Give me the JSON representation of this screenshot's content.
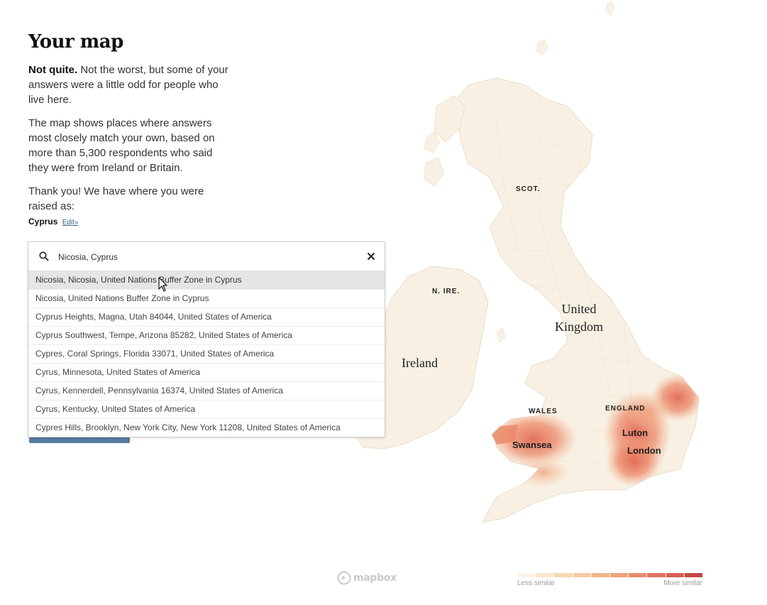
{
  "panel": {
    "title": "Your map",
    "result_lead": "Not quite.",
    "result_text": " Not the worst, but some of your answers were a little odd for people who live here.",
    "explanation": "The map shows places where answers most closely match your own, based on more than 5,300 respondents who said they were from Ireland or Britain.",
    "thanks": "Thank you! We have where you were raised as:",
    "place": "Cyprus",
    "edit_label": "Edit»"
  },
  "search": {
    "value": "Nicosia, Cyprus",
    "suggestions": [
      "Nicosia, Nicosia, United Nations Buffer Zone in Cyprus",
      "Nicosia, United Nations Buffer Zone in Cyprus",
      "Cyprus Heights, Magna, Utah 84044, United States of America",
      "Cyprus Southwest, Tempe, Arizona 85282, United States of America",
      "Cypres, Coral Springs, Florida 33071, United States of America",
      "Cyrus, Minnesota, United States of America",
      "Cyrus, Kennerdell, Pennsylvania 16374, United States of America",
      "Cyrus, Kentucky, United States of America",
      "Cypres Hills, Brooklyn, New York City, New York 11208, United States of America"
    ],
    "active_index": 0
  },
  "map": {
    "labels": {
      "scot": "SCOT.",
      "nire": "N. IRE.",
      "uk_line1": "United",
      "uk_line2": "Kingdom",
      "ireland": "Ireland",
      "wales": "WALES",
      "england": "ENGLAND",
      "swansea": "Swansea",
      "luton": "Luton",
      "london": "London"
    },
    "attribution": "mapbox",
    "land_color": "#f8f1e3",
    "border_color": "#ede2cf",
    "hot_colors": [
      "#f3b08e",
      "#ec8a6a",
      "#e36a55"
    ]
  },
  "legend": {
    "low_label": "Less similar",
    "high_label": "More similar",
    "colors": [
      "#fcf2e6",
      "#fae5cd",
      "#f8d8b4",
      "#f6cba0",
      "#f3b68c",
      "#efa07c",
      "#ea8a6d",
      "#e2735f",
      "#d75f53",
      "#c44944"
    ]
  }
}
